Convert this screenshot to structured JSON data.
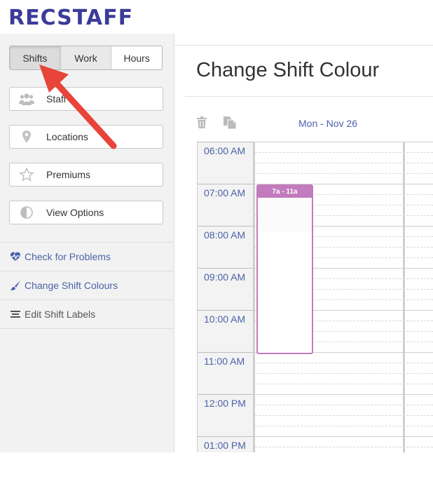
{
  "app": {
    "logo": "RECSTAFF"
  },
  "sidebar": {
    "segments": [
      {
        "label": "Shifts",
        "active": true
      },
      {
        "label": "Work",
        "active": false
      },
      {
        "label": "Hours",
        "active": false
      }
    ],
    "buttons": [
      {
        "label": "Staff",
        "icon": "users-icon"
      },
      {
        "label": "Locations",
        "icon": "map-pin-icon"
      },
      {
        "label": "Premiums",
        "icon": "star-icon"
      },
      {
        "label": "View Options",
        "icon": "contrast-icon"
      }
    ],
    "links": [
      {
        "label": "Check for Problems",
        "icon": "heartbeat-icon"
      },
      {
        "label": "Change Shift Colours",
        "icon": "paint-brush-icon"
      },
      {
        "label": "Edit Shift Labels",
        "icon": "text-lines-icon"
      }
    ]
  },
  "main": {
    "title": "Change Shift Colour",
    "toolbar": {
      "delete_icon": "trash-icon",
      "copy_icon": "copy-icon"
    },
    "calendar": {
      "day_header": "Mon - Nov 26",
      "times": [
        "06:00 AM",
        "07:00 AM",
        "08:00 AM",
        "09:00 AM",
        "10:00 AM",
        "11:00 AM",
        "12:00 PM",
        "01:00 PM"
      ],
      "shift": {
        "label": "7a - 11a",
        "color": "#c27bbd"
      }
    }
  },
  "colors": {
    "accent": "#4a62a8",
    "logo": "#3b3b9a",
    "annotation_arrow": "#e8443a"
  }
}
